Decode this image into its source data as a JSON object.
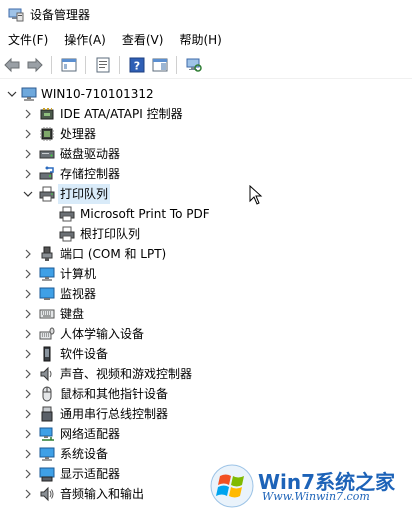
{
  "window": {
    "title": "设备管理器"
  },
  "menu": [
    "文件(F)",
    "操作(A)",
    "查看(V)",
    "帮助(H)"
  ],
  "toolbar": [
    {
      "icon": "back-arrow-icon"
    },
    {
      "icon": "forward-arrow-icon"
    },
    {
      "icon": "show-hide-console-tree-icon"
    },
    {
      "icon": "properties-icon"
    },
    {
      "icon": "help-icon"
    },
    {
      "icon": "action-pane-icon"
    },
    {
      "icon": "scan-hardware-icon"
    }
  ],
  "tree": {
    "root": "WIN10-710101312",
    "categories": [
      {
        "label": "IDE ATA/ATAPI 控制器",
        "icon": "ide-controller-icon"
      },
      {
        "label": "处理器",
        "icon": "processor-icon"
      },
      {
        "label": "磁盘驱动器",
        "icon": "disk-drive-icon"
      },
      {
        "label": "存储控制器",
        "icon": "storage-controller-icon"
      },
      {
        "label": "打印队列",
        "icon": "printer-icon",
        "expanded": true,
        "selected": true,
        "children": [
          {
            "label": "Microsoft Print To PDF",
            "icon": "printer-icon"
          },
          {
            "label": "根打印队列",
            "icon": "printer-icon"
          }
        ]
      },
      {
        "label": "端口 (COM 和 LPT)",
        "icon": "port-icon"
      },
      {
        "label": "计算机",
        "icon": "computer-icon"
      },
      {
        "label": "监视器",
        "icon": "monitor-icon"
      },
      {
        "label": "键盘",
        "icon": "keyboard-icon"
      },
      {
        "label": "人体学输入设备",
        "icon": "hid-icon"
      },
      {
        "label": "软件设备",
        "icon": "software-device-icon"
      },
      {
        "label": "声音、视频和游戏控制器",
        "icon": "speaker-icon"
      },
      {
        "label": "鼠标和其他指针设备",
        "icon": "mouse-icon"
      },
      {
        "label": "通用串行总线控制器",
        "icon": "usb-icon"
      },
      {
        "label": "网络适配器",
        "icon": "network-adapter-icon"
      },
      {
        "label": "系统设备",
        "icon": "system-device-icon"
      },
      {
        "label": "显示适配器",
        "icon": "display-adapter-icon"
      },
      {
        "label": "音频输入和输出",
        "icon": "audio-io-icon"
      }
    ]
  },
  "watermark": {
    "name": "Win7系统之家",
    "url": "Www.Winwin7.com"
  }
}
